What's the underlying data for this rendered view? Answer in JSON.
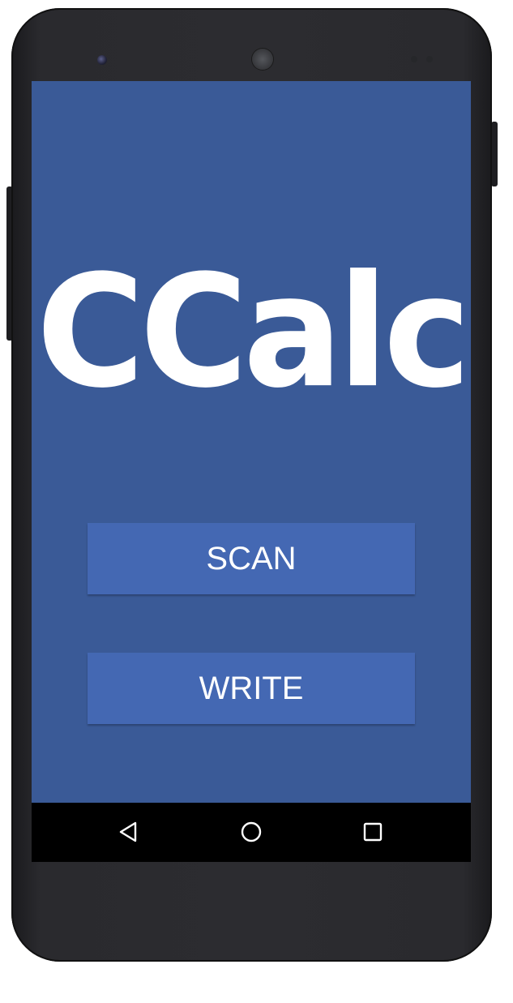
{
  "app": {
    "title": "CCalc"
  },
  "buttons": {
    "scan_label": "SCAN",
    "write_label": "WRITE"
  },
  "navigation": {
    "back_icon": "back-triangle-icon",
    "home_icon": "home-circle-icon",
    "recents_icon": "recents-square-icon"
  },
  "colors": {
    "screen_background": "#3a5a97",
    "button_background": "#4468b3",
    "text": "#ffffff",
    "navbar_background": "#000000"
  }
}
